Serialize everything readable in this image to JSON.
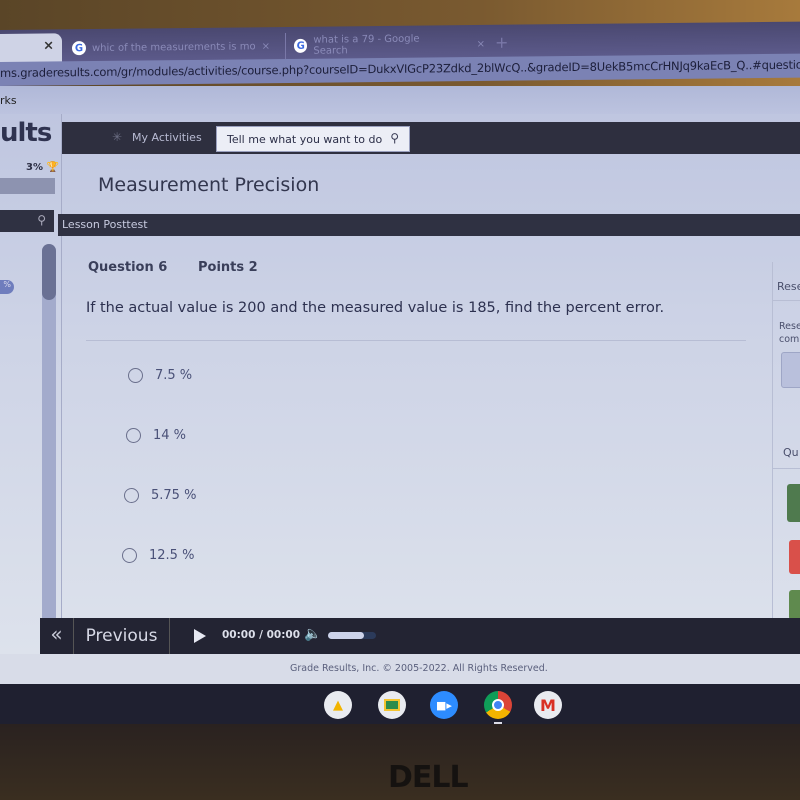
{
  "browser": {
    "tabs": [
      {
        "label": "",
        "active": true
      },
      {
        "label": "whic of the measurements is mo",
        "active": false,
        "favicon": "google-icon"
      },
      {
        "label": "what is a 79 - Google Search",
        "active": false,
        "favicon": "google-icon"
      }
    ],
    "close_glyph": "×",
    "new_tab_glyph": "+",
    "url": "ms.graderesults.com/gr/modules/activities/course.php?courseID=DukxVIGcP23Zdkd_2blWcQ..&gradeID=8UekB5mcCrHNJq9kaEcB_Q..#questionC",
    "bookmarks_label": "rks"
  },
  "app": {
    "logo": "ults",
    "progress_percent": "3%",
    "trophy_glyph": "🏆",
    "nav": {
      "my_activities": "My Activities",
      "search_placeholder": "Tell me what you want to do",
      "search_glyph": "🔍"
    },
    "left": {
      "pill": "%",
      "search_glyph": "🔍",
      "scroll_position": 0.0
    },
    "page_title": "Measurement Precision",
    "section": "Lesson Posttest"
  },
  "question": {
    "number_label": "Question 6",
    "points_label": "Points 2",
    "text": "If the actual value is 200 and the measured value is 185, find the percent error.",
    "options": [
      "7.5 %",
      "14 %",
      "5.75 %",
      "12.5 %"
    ],
    "selected": null
  },
  "right_panel": {
    "heading1": "Rese",
    "text_line1": "Rese",
    "text_line2": "com",
    "heading2": "Qu",
    "status_colors": [
      "#4f7a4e",
      "#d9504a",
      "#5f8a4e"
    ]
  },
  "bottom": {
    "first_glyph": "«",
    "previous_label": "Previous",
    "time_current": "00:00",
    "time_sep": "/",
    "time_total": "00:00",
    "volume_level": 0.75,
    "volume_glyph": "🔊"
  },
  "footer": {
    "copyright": "Grade Results, Inc. © 2005-2022. All Rights Reserved."
  },
  "shelf": {
    "apps": [
      "Google Drive",
      "Google Classroom",
      "Zoom",
      "Chrome",
      "Gmail"
    ],
    "gmail_glyph": "M",
    "drive_glyph": "▲"
  },
  "device": {
    "brand": "DELL"
  }
}
